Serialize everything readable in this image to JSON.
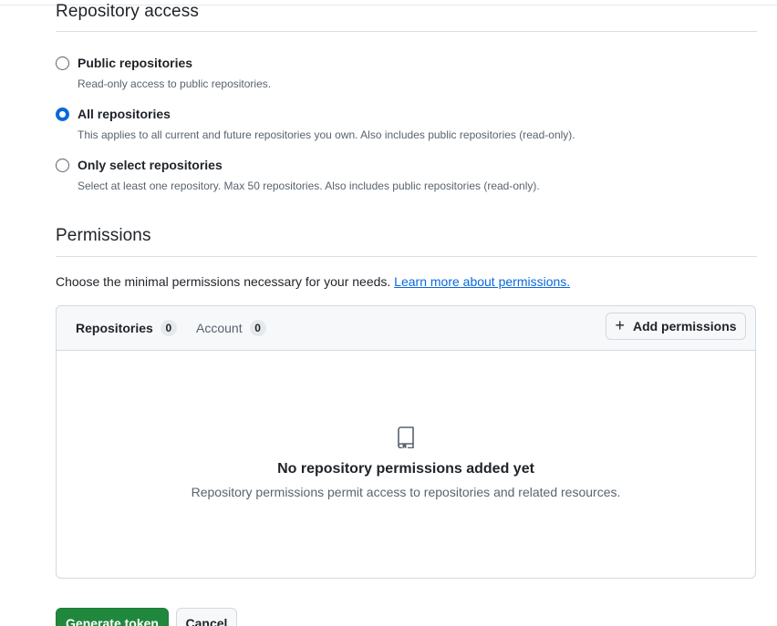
{
  "repository_access": {
    "title": "Repository access",
    "options": [
      {
        "label": "Public repositories",
        "description": "Read-only access to public repositories.",
        "checked": false
      },
      {
        "label": "All repositories",
        "description": "This applies to all current and future repositories you own. Also includes public repositories (read-only).",
        "checked": true
      },
      {
        "label": "Only select repositories",
        "description": "Select at least one repository. Max 50 repositories. Also includes public repositories (read-only).",
        "checked": false
      }
    ]
  },
  "permissions": {
    "title": "Permissions",
    "intro_text": "Choose the minimal permissions necessary for your needs.",
    "learn_more_link": "Learn more about permissions.",
    "tabs": [
      {
        "label": "Repositories",
        "count": "0",
        "active": true
      },
      {
        "label": "Account",
        "count": "0",
        "active": false
      }
    ],
    "add_button_label": "Add permissions",
    "add_button_icon": "plus-icon",
    "empty_state": {
      "icon": "repo-icon",
      "title": "No repository permissions added yet",
      "description": "Repository permissions permit access to repositories and related resources."
    }
  },
  "actions": {
    "generate_label": "Generate token",
    "cancel_label": "Cancel"
  },
  "colors": {
    "accent": "#0969da",
    "primary_button": "#1f883d",
    "muted_text": "#59636e"
  }
}
